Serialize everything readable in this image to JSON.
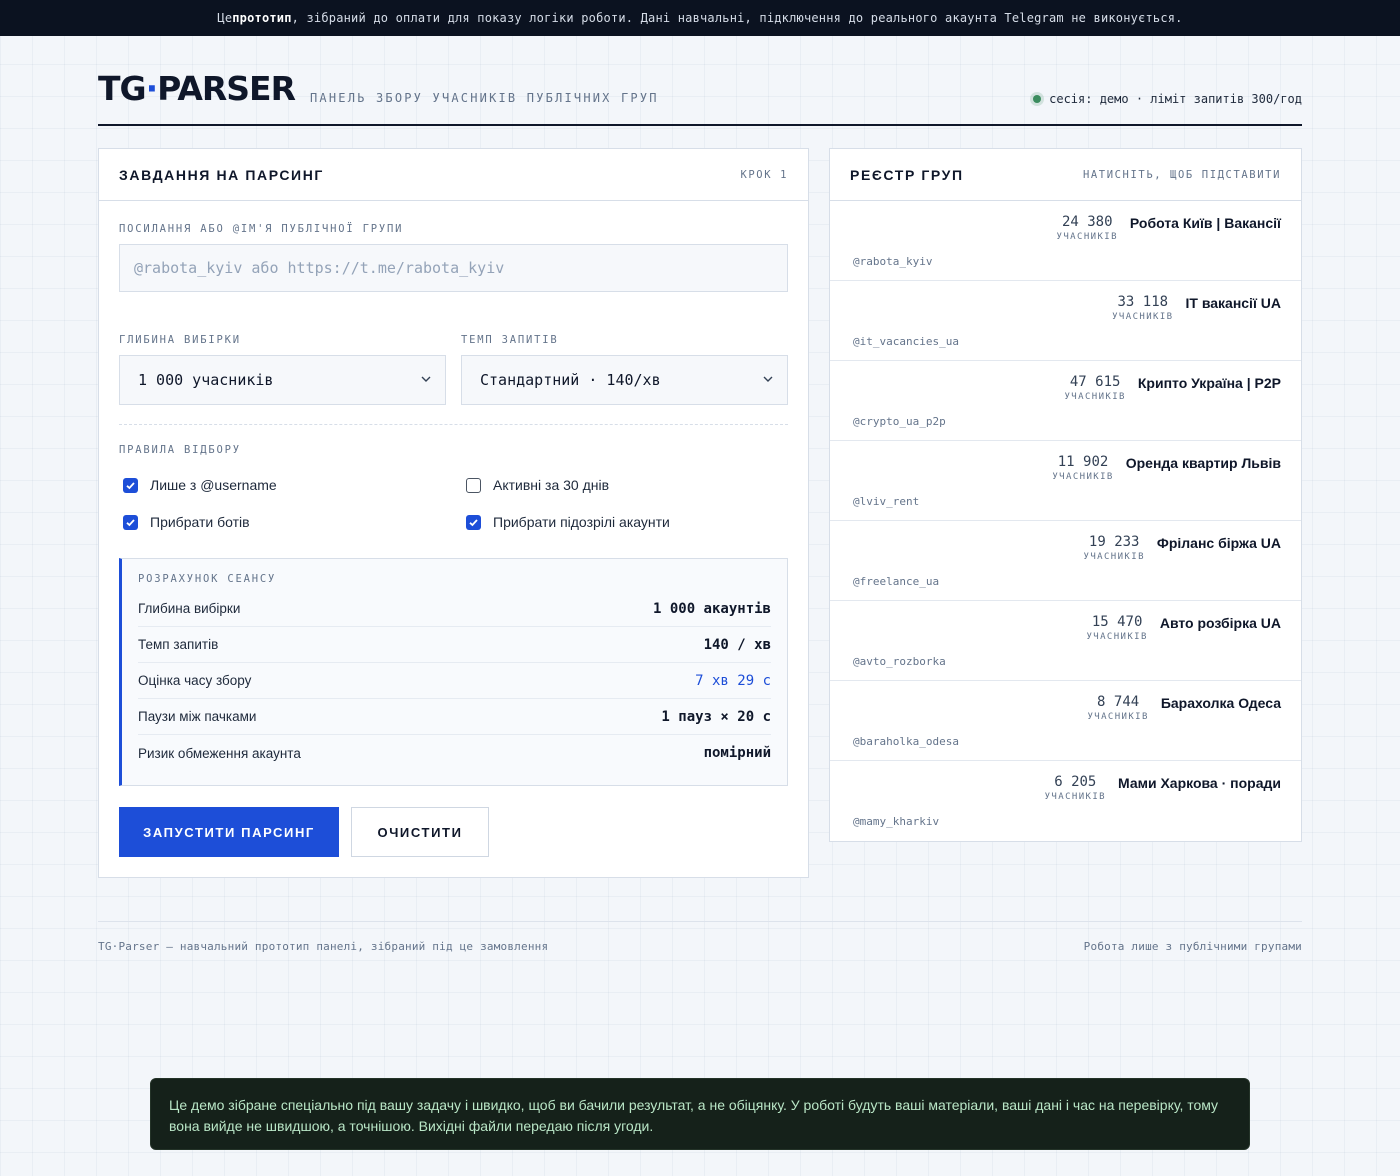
{
  "banner": {
    "prefix": "Це ",
    "bold": "прототип",
    "suffix": ", зібраний до оплати для показу логіки роботи. Дані навчальні, підключення до реального акаунта Telegram не виконується."
  },
  "header": {
    "logo_left": "TG",
    "logo_dot": "·",
    "logo_right": "PARSER",
    "tagline": "ПАНЕЛЬ ЗБОРУ УЧАСНИКІВ ПУБЛІЧНИХ ГРУП",
    "session": "сесія: демо · ліміт запитів 300/год",
    "status_color": "#3b8c5e"
  },
  "task": {
    "title": "ЗАВДАННЯ НА ПАРСИНГ",
    "step": "КРОК 1",
    "link_label": "ПОСИЛАННЯ АБО @ІМ'Я ПУБЛІЧНОЇ ГРУПИ",
    "link_placeholder": "@rabota_kyiv або https://t.me/rabota_kyiv",
    "link_value": "",
    "depth_label": "ГЛИБИНА ВИБІРКИ",
    "depth_value": "1 000 учасників",
    "rate_label": "ТЕМП ЗАПИТІВ",
    "rate_value": "Стандартний · 140/хв",
    "rules_label": "ПРАВИЛА ВІДБОРУ",
    "rules": [
      {
        "label": "Лише з @username",
        "checked": true
      },
      {
        "label": "Активні за 30 днів",
        "checked": false
      },
      {
        "label": "Прибрати ботів",
        "checked": true
      },
      {
        "label": "Прибрати підозрілі акаунти",
        "checked": true
      }
    ],
    "calc": {
      "title": "РОЗРАХУНОК СЕАНСУ",
      "rows": [
        {
          "label": "Глибина вибірки",
          "value": "1 000 акаунтів"
        },
        {
          "label": "Темп запитів",
          "value": "140 / хв"
        },
        {
          "label": "Оцінка часу збору",
          "value": "7 хв 29 с"
        },
        {
          "label": "Паузи між пачками",
          "value": "1 пауз × 20 с"
        },
        {
          "label": "Ризик обмеження акаунта",
          "value": "помірний"
        }
      ]
    },
    "start_label": "ЗАПУСТИТИ ПАРСИНГ",
    "clear_label": "ОЧИСТИТИ",
    "accent_color": "#1d4ed8"
  },
  "registry": {
    "title": "РЕЄСТР ГРУП",
    "hint": "НАТИСНІТЬ, ЩОБ ПІДСТАВИТИ",
    "members_label": "УЧАСНИКІВ",
    "groups": [
      {
        "count": "24 380",
        "name": "Робота Київ | Вакансії",
        "handle": "@rabota_kyiv"
      },
      {
        "count": "33 118",
        "name": "IT вакансії UA",
        "handle": "@it_vacancies_ua"
      },
      {
        "count": "47 615",
        "name": "Крипто Україна | P2P",
        "handle": "@crypto_ua_p2p"
      },
      {
        "count": "11 902",
        "name": "Оренда квартир Львів",
        "handle": "@lviv_rent"
      },
      {
        "count": "19 233",
        "name": "Фріланс біржа UA",
        "handle": "@freelance_ua"
      },
      {
        "count": "15 470",
        "name": "Авто розбірка UA",
        "handle": "@avto_rozborka"
      },
      {
        "count": "8 744",
        "name": "Барахолка Одеса",
        "handle": "@baraholka_odesa"
      },
      {
        "count": "6 205",
        "name": "Мами Харкова · поради",
        "handle": "@mamy_kharkiv"
      }
    ]
  },
  "footer": {
    "left": "TG·Parser — навчальний прототип панелі, зібраний під це замовлення",
    "right": "Робота лише з публічними групами"
  },
  "toast": {
    "text": "Це демо зібране спеціально під вашу задачу і швидко, щоб ви бачили результат, а не обіцянку. У роботі будуть ваші матеріали, ваші дані і час на перевірку, тому вона вийде не швидшою, а точнішою. Вихідні файли передаю після угоди."
  }
}
